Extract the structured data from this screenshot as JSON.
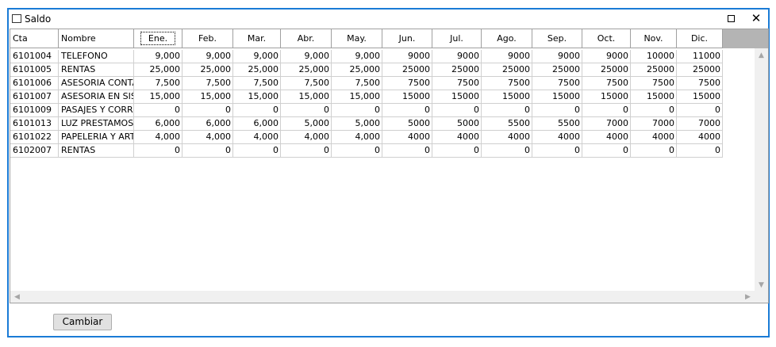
{
  "window": {
    "title": "Saldo",
    "close_glyph": "✕",
    "maximize_icon": "maximize-icon",
    "icon": "window-icon"
  },
  "table": {
    "columns": [
      "Cta",
      "Nombre",
      "Ene.",
      "Feb.",
      "Mar.",
      "Abr.",
      "May.",
      "Jun.",
      "Jul.",
      "Ago.",
      "Sep.",
      "Oct.",
      "Nov.",
      "Dic."
    ],
    "rows": [
      [
        "6101004",
        "TELEFONO",
        "9,000",
        "9,000",
        "9,000",
        "9,000",
        "9,000",
        "9000",
        "9000",
        "9000",
        "9000",
        "9000",
        "10000",
        "11000"
      ],
      [
        "6101005",
        "RENTAS",
        "25,000",
        "25,000",
        "25,000",
        "25,000",
        "25,000",
        "25000",
        "25000",
        "25000",
        "25000",
        "25000",
        "25000",
        "25000"
      ],
      [
        "6101006",
        "ASESORIA CONTABLE",
        "7,500",
        "7,500",
        "7,500",
        "7,500",
        "7,500",
        "7500",
        "7500",
        "7500",
        "7500",
        "7500",
        "7500",
        "7500"
      ],
      [
        "6101007",
        "ASESORIA EN SISTEMAS",
        "15,000",
        "15,000",
        "15,000",
        "15,000",
        "15,000",
        "15000",
        "15000",
        "15000",
        "15000",
        "15000",
        "15000",
        "15000"
      ],
      [
        "6101009",
        "PASAJES Y CORREOS",
        "0",
        "0",
        "0",
        "0",
        "0",
        "0",
        "0",
        "0",
        "0",
        "0",
        "0",
        "0"
      ],
      [
        "6101013",
        "LUZ    PRESTAMOS",
        "6,000",
        "6,000",
        "6,000",
        "5,000",
        "5,000",
        "5000",
        "5000",
        "5500",
        "5500",
        "7000",
        "7000",
        "7000"
      ],
      [
        "6101022",
        "PAPELERIA Y ARTICULOS",
        "4,000",
        "4,000",
        "4,000",
        "4,000",
        "4,000",
        "4000",
        "4000",
        "4000",
        "4000",
        "4000",
        "4000",
        "4000"
      ],
      [
        "6102007",
        "RENTAS",
        "0",
        "0",
        "0",
        "0",
        "0",
        "0",
        "0",
        "0",
        "0",
        "0",
        "0",
        "0"
      ]
    ]
  },
  "scrollbars": {
    "up": "▲",
    "down": "▼",
    "left": "◀",
    "right": "▶"
  },
  "buttons": {
    "cambiar": "Cambiar"
  }
}
